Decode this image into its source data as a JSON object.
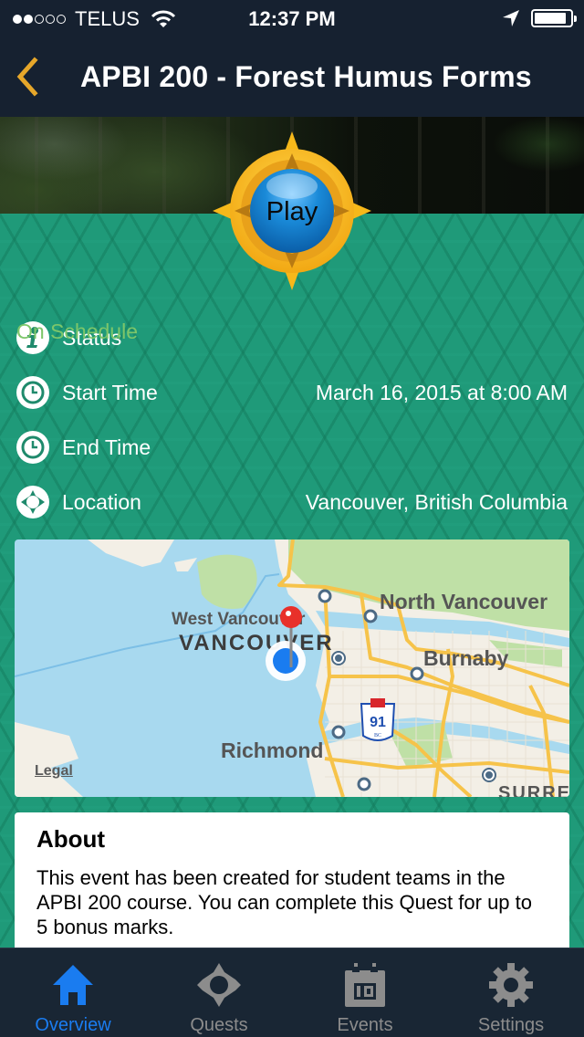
{
  "status_bar": {
    "signal_bars_filled": 2,
    "signal_bars_total": 5,
    "carrier": "TELUS",
    "time": "12:37 PM",
    "battery_percent": 90
  },
  "nav": {
    "title": "APBI 200 - Forest Humus Forms",
    "accent_color": "#e6a72a"
  },
  "play_button": {
    "label": "Play"
  },
  "details": [
    {
      "icon": "info-icon",
      "label": "Status",
      "value": "On Schedule"
    },
    {
      "icon": "clock-icon",
      "label": "Start Time",
      "value": "March 16, 2015 at 8:00 AM"
    },
    {
      "icon": "clock-icon",
      "label": "End Time",
      "value": ""
    },
    {
      "icon": "compass-icon",
      "label": "Location",
      "value": "Vancouver, British Columbia"
    }
  ],
  "map": {
    "labels": {
      "west_vancouver": "West Vancouver",
      "vancouver": "VANCOUVER",
      "north_vancouver": "North Vancouver",
      "burnaby": "Burnaby",
      "richmond": "Richmond",
      "surrey": "SURREY",
      "highway_number": "91",
      "highway_region": "BC"
    },
    "legal": "Legal"
  },
  "about": {
    "title": "About",
    "body": "This event has been created for student teams in the APBI 200 course. You can complete this Quest for up to 5 bonus marks."
  },
  "tabs": [
    {
      "label": "Overview",
      "icon": "home-icon",
      "active": true
    },
    {
      "label": "Quests",
      "icon": "compass-icon",
      "active": false
    },
    {
      "label": "Events",
      "icon": "calendar-icon",
      "active": false
    },
    {
      "label": "Settings",
      "icon": "gear-icon",
      "active": false
    }
  ],
  "colors": {
    "background_green": "#1f9a79",
    "status_ok": "#7dc66a",
    "tab_active": "#1a7cf0",
    "tab_inactive": "#8c8c8c"
  }
}
